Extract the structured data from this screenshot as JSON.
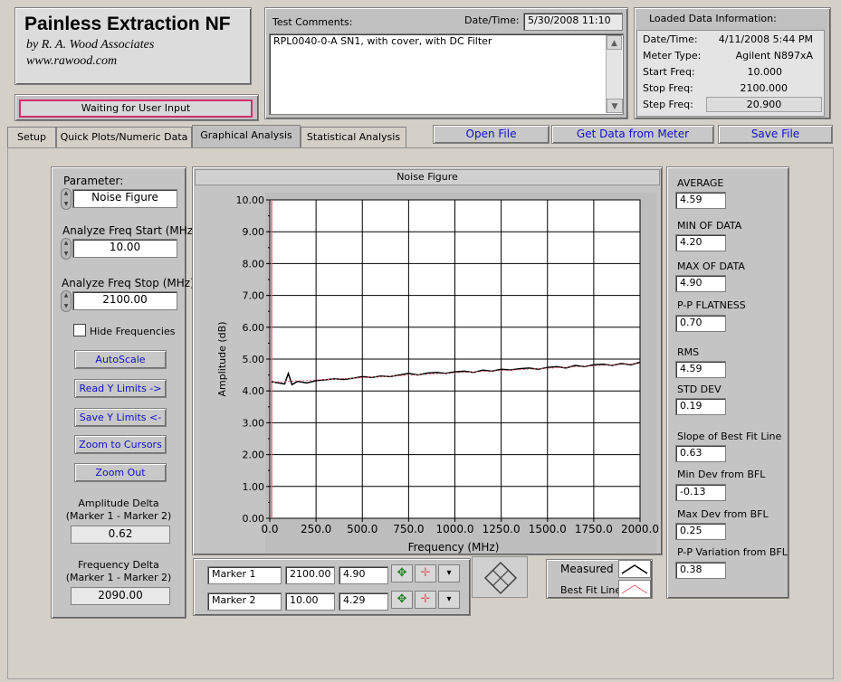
{
  "app": {
    "title": "Painless Extraction NF",
    "author": "by R. A. Wood Associates",
    "website": "www.rawood.com",
    "status": "Waiting for User Input"
  },
  "comments": {
    "label": "Test Comments:",
    "datetime_label": "Date/Time:",
    "datetime_value": "5/30/2008  11:10",
    "text": "RPL0040-0-A SN1, with cover, with DC Filter"
  },
  "loaded": {
    "title": "Loaded Data Information:",
    "rows": [
      {
        "label": "Date/Time:",
        "value": "4/11/2008  5:44 PM"
      },
      {
        "label": "Meter Type:",
        "value": "Agilent N897xA"
      },
      {
        "label": "Start Freq:",
        "value": "10.000"
      },
      {
        "label": "Stop Freq:",
        "value": "2100.000"
      },
      {
        "label": "Step Freq:",
        "value": "20.900"
      }
    ]
  },
  "tabs": [
    "Setup",
    "Quick Plots/Numeric Data",
    "Graphical Analysis",
    "Statistical Analysis"
  ],
  "file_buttons": {
    "open": "Open File",
    "get": "Get Data from Meter",
    "save": "Save File"
  },
  "left": {
    "parameter_label": "Parameter:",
    "parameter_value": "Noise Figure",
    "start_label": "Analyze Freq Start (MHz)",
    "start_value": "10.00",
    "stop_label": "Analyze Freq Stop (MHz)",
    "stop_value": "2100.00",
    "hide_label": "Hide Frequencies",
    "buttons": [
      "AutoScale",
      "Read Y Limits ->",
      "Save Y Limits <-",
      "Zoom to Cursors",
      "Zoom Out"
    ],
    "amp_delta_label1": "Amplitude Delta",
    "amp_delta_label2": "(Marker 1 - Marker 2)",
    "amp_delta_value": "0.62",
    "freq_delta_label1": "Frequency Delta",
    "freq_delta_label2": "(Marker 1 - Marker 2)",
    "freq_delta_value": "2090.00"
  },
  "markers": [
    {
      "name": "Marker 1",
      "freq": "2100.00",
      "amp": "4.90"
    },
    {
      "name": "Marker 2",
      "freq": "10.00",
      "amp": "4.29"
    }
  ],
  "legend": {
    "measured": "Measured",
    "bestfit": "Best Fit Line"
  },
  "stats": [
    {
      "label": "AVERAGE",
      "value": "4.59"
    },
    {
      "label": "MIN OF DATA",
      "value": "4.20"
    },
    {
      "label": "MAX OF DATA",
      "value": "4.90"
    },
    {
      "label": "P-P FLATNESS",
      "value": "0.70"
    },
    {
      "label": "RMS",
      "value": "4.59"
    },
    {
      "label": "STD DEV",
      "value": "0.19"
    },
    {
      "label": "Slope of Best Fit Line",
      "value": "0.63"
    },
    {
      "label": "Min Dev from BFL",
      "value": "-0.13"
    },
    {
      "label": "Max Dev from BFL",
      "value": "0.25"
    },
    {
      "label": "P-P Variation from BFL",
      "value": "0.38"
    }
  ],
  "colors": {
    "measured": "#000000",
    "bestfit": "#e06070",
    "status_border": "#d0306a",
    "button_text": "#1010c8"
  },
  "chart_data": {
    "type": "line",
    "title": "Noise Figure",
    "xlabel": "Frequency (MHz)",
    "ylabel": "Amplitude (dB)",
    "xlim": [
      0,
      2000
    ],
    "ylim": [
      0,
      10
    ],
    "x_ticks": [
      "0.0",
      "250.0",
      "500.0",
      "750.0",
      "1000.0",
      "1250.0",
      "1500.0",
      "1750.0",
      "2000.0"
    ],
    "y_ticks": [
      "0.00",
      "1.00",
      "2.00",
      "3.00",
      "4.00",
      "5.00",
      "6.00",
      "7.00",
      "8.00",
      "9.00",
      "10.00"
    ],
    "grid": true,
    "cursor_x": 10,
    "series": [
      {
        "name": "Measured",
        "x": [
          10,
          50,
          80,
          100,
          120,
          150,
          200,
          250,
          300,
          350,
          400,
          450,
          500,
          550,
          600,
          650,
          700,
          750,
          800,
          850,
          900,
          950,
          1000,
          1050,
          1100,
          1150,
          1200,
          1250,
          1300,
          1350,
          1400,
          1450,
          1500,
          1550,
          1600,
          1650,
          1700,
          1750,
          1800,
          1850,
          1900,
          1950,
          2000
        ],
        "y": [
          4.29,
          4.25,
          4.22,
          4.55,
          4.2,
          4.3,
          4.25,
          4.32,
          4.35,
          4.38,
          4.36,
          4.4,
          4.45,
          4.42,
          4.47,
          4.45,
          4.5,
          4.55,
          4.5,
          4.56,
          4.58,
          4.55,
          4.6,
          4.62,
          4.58,
          4.65,
          4.62,
          4.68,
          4.66,
          4.7,
          4.72,
          4.68,
          4.74,
          4.76,
          4.72,
          4.8,
          4.76,
          4.82,
          4.84,
          4.8,
          4.86,
          4.82,
          4.9
        ]
      },
      {
        "name": "Best Fit Line",
        "x": [
          0,
          2000
        ],
        "y": [
          4.27,
          4.86
        ]
      }
    ]
  }
}
